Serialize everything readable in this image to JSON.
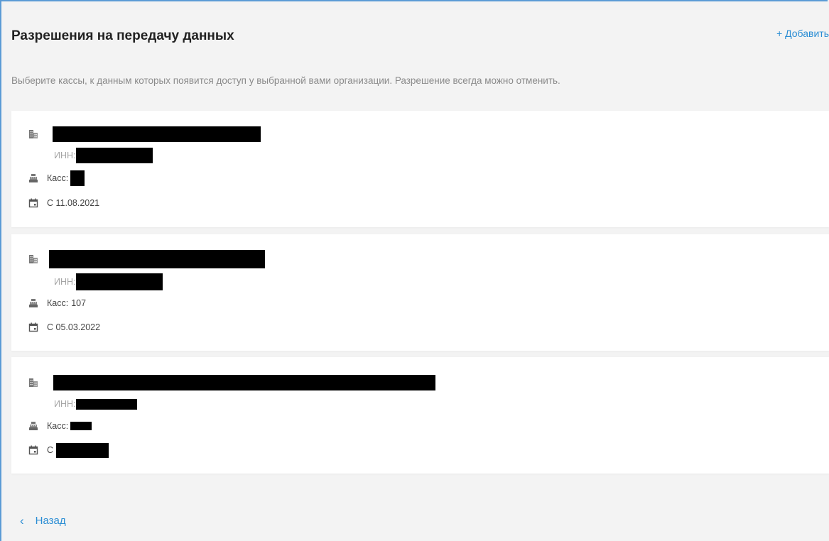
{
  "header": {
    "title": "Разрешения на передачу данных",
    "add_label": "+ Добавить",
    "subtitle": "Выберите кассы, к данным которых появится доступ у выбранной вами организации. Разрешение всегда можно отменить."
  },
  "permissions": [
    {
      "inn_label": "ИНН:",
      "kass_label": "Касс:",
      "kass_value": "",
      "date_text": "С 11.08.2021"
    },
    {
      "inn_label": "ИНН:",
      "kass_label": "Касс:",
      "kass_value": "107",
      "date_text": "С 05.03.2022"
    },
    {
      "inn_label": "ИНН:",
      "kass_label": "Касс:",
      "kass_value": "",
      "date_text": "С"
    }
  ],
  "footer": {
    "back_label": "Назад"
  },
  "colors": {
    "accent": "#2a8dd4",
    "frame_border": "#5b9bd5",
    "background": "#f3f3f3",
    "card": "#ffffff"
  },
  "icons": [
    "building-icon",
    "cash-register-icon",
    "calendar-icon",
    "chevron-left-icon"
  ]
}
